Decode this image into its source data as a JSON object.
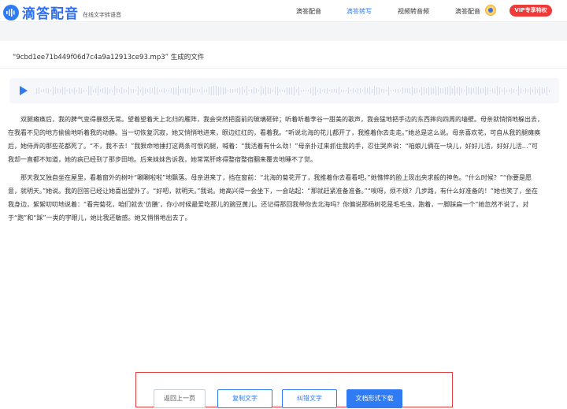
{
  "header": {
    "logo_text": "滴答配音",
    "logo_sub": "在线文字转语音",
    "nav": [
      {
        "label": "滴答配音"
      },
      {
        "label": "滴答转写"
      },
      {
        "label": "视频转音频"
      },
      {
        "label": "滴答配音"
      }
    ],
    "vip_label": "VIP专享特权",
    "active_nav": "滴答转写",
    "accent_color": "#2e7bf4"
  },
  "file": {
    "title": "“9cbd1ee71b449f06d7c4a9a12913ce93.mp3” 生成的文件"
  },
  "player": {
    "play_icon": "play-icon"
  },
  "transcript": {
    "paragraphs": [
      "双腿瘫痪后，我的脾气变得暴怒无常。望着望着天上北归的雁阵，我会突然把面前的玻璃砸碎；听着听着李谷一甜美的歌声，我会猛地把手边的东西摔向四周的墙壁。母亲就悄悄地躲出去，在我看不见的地方偷偷地听着我的动静。当一切恢复沉寂，她又悄悄地进来，眼边红红的，看着我。“听说北海的花儿都开了，我推着你去走走。”她总是这么说。母亲喜欢花，可自从我的腿瘫痪后，她侍弄的那些花都死了。“不，我不去！”我狠命地捶打这两条可恨的腿，喊着：“我活着有什么劲！”母亲扑过来抓住我的手，忍住哭声说：“咱娘儿俩在一块儿，好好儿活，好好儿活…”可我却一直都不知道，她的病已经到了那步田地。后来妹妹告诉我，她常常肝疼得整宿整宿翻来覆去地睡不了觉。",
      "那天我又独自坐在屋里，看着窗外的树叶“唰唰啦啦”地飘落。母亲进来了，挡在窗前：“北海的菊花开了，我推着你去看看吧。”她憔悴的脸上现出央求般的神色。“什么时候？”“你要是愿意，就明天。”她说。我的回答已经让她喜出望外了。“好吧，就明天。”我说。她高兴得一会坐下，一会站起：“那就赶紧准备准备。”“唉呀，烦不烦？几步路，有什么好准备的！”她也笑了，坐在我身边，絮絮叨叨地说着：“看完菊花，咱们就去‘仿膳’，你小时候最爱吃那儿的豌豆黄儿。还记得那回我带你去北海吗？你偏说那杨树花是毛毛虫，跑着，一脚踩扁一个”她忽然不说了。对于“跑”和“踩”一类的字眼儿，她比我还敏感。她又悄悄地出去了。"
    ]
  },
  "actions": {
    "back_label": "返回上一页",
    "copy_label": "复制文字",
    "fix_label": "纠错文字",
    "download_label": "文档形式下载"
  }
}
